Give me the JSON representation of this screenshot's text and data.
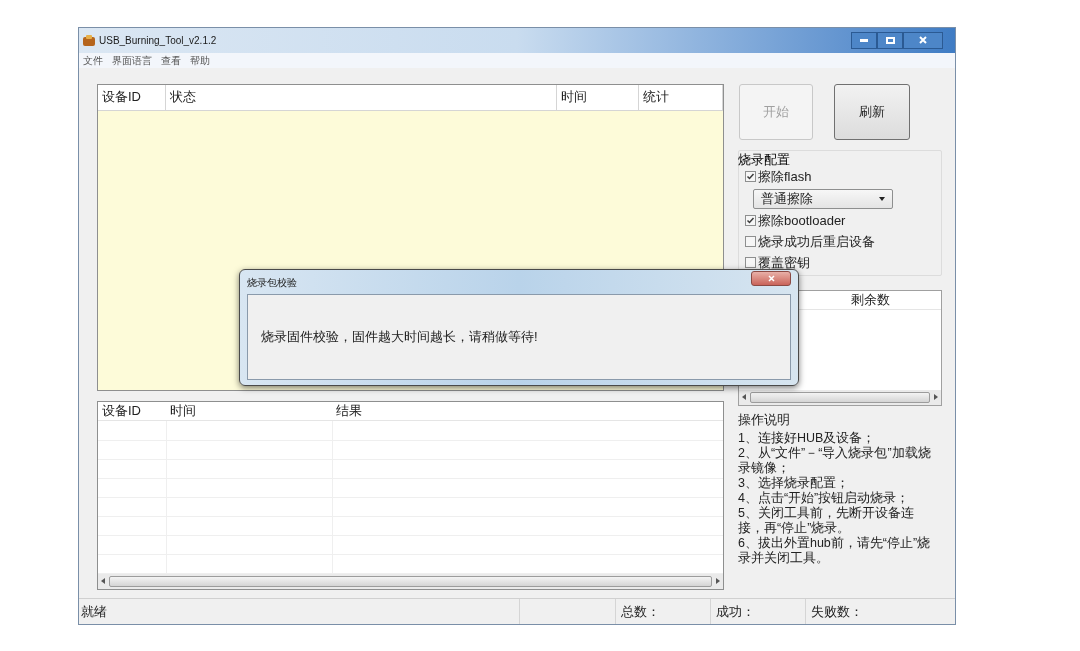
{
  "window": {
    "title": "USB_Burning_Tool_v2.1.2"
  },
  "menu": [
    "文件",
    "界面语言",
    "查看",
    "帮助"
  ],
  "device_table": {
    "columns": [
      "设备ID",
      "状态",
      "时间",
      "统计"
    ]
  },
  "buttons": [
    {
      "label": "开始",
      "disabled": true
    },
    {
      "label": "刷新",
      "disabled": false
    }
  ],
  "burn_config": {
    "title": "烧录配置",
    "options": [
      {
        "kind": "checkbox",
        "label": "擦除flash",
        "checked": true
      },
      {
        "kind": "dropdown",
        "value": "普通擦除"
      },
      {
        "kind": "checkbox",
        "label": "擦除bootloader",
        "checked": true
      },
      {
        "kind": "checkbox",
        "label": "烧录成功后重启设备",
        "checked": false
      },
      {
        "kind": "checkbox",
        "label": "覆盖密钥",
        "checked": false
      }
    ]
  },
  "remaining_list": {
    "columns": [
      "剩余数"
    ]
  },
  "instructions": {
    "title": "操作说明",
    "items": [
      "1、连接好HUB及设备；",
      "2、从“文件”－“导入烧录包”加载烧录镜像；",
      "3、选择烧录配置；",
      "4、点击“开始”按钮启动烧录；",
      "5、关闭工具前，先断开设备连接，再“停止”烧录。",
      "6、拔出外置hub前，请先“停止”烧录并关闭工具。"
    ]
  },
  "result_table": {
    "columns": [
      "设备ID",
      "时间",
      "结果"
    ]
  },
  "status_bar": [
    "就绪",
    "总数：",
    "成功：",
    "失败数："
  ],
  "dialog": {
    "title": "烧录包校验",
    "message": "烧录固件校验，固件越大时间越长，请稍做等待!"
  }
}
